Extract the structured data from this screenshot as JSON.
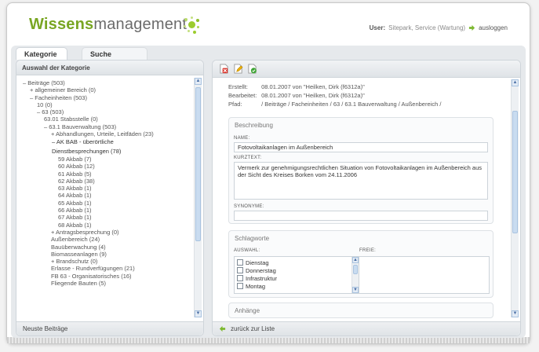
{
  "header": {
    "logo_strong": "Wissens",
    "logo_light": "management",
    "user_label": "User:",
    "user_value": "Sitepark, Service (Wartung)",
    "logout": "ausloggen"
  },
  "tabs": [
    {
      "label": "Kategorie",
      "active": true
    },
    {
      "label": "Suche",
      "active": false
    }
  ],
  "left": {
    "title": "Auswahl der Kategorie",
    "footer": "Neuste Beiträge",
    "tree": [
      {
        "text": "– Beiträge (503)",
        "indent": 0
      },
      {
        "text": "+ allgemeiner Bereich (0)",
        "indent": 1
      },
      {
        "text": "– Facheinheiten (503)",
        "indent": 1
      },
      {
        "text": "10 (0)",
        "indent": 2
      },
      {
        "text": "– 63 (503)",
        "indent": 2
      },
      {
        "text": "63.01 Stabsstelle (0)",
        "indent": 3
      },
      {
        "text": "– 63.1 Bauverwaltung (503)",
        "indent": 3
      },
      {
        "text": "+ Abhandlungen, Urteile, Leitfäden (23)",
        "indent": 4
      },
      {
        "text": "– AK BAB - überörtliche",
        "indent": 4,
        "selected": true
      },
      {
        "text": "Dienstbesprechungen (78)",
        "indent": 4,
        "selected": true
      },
      {
        "text": "59 Akbab (7)",
        "indent": 5
      },
      {
        "text": "60 Akbab (12)",
        "indent": 5
      },
      {
        "text": "61 Akbab (5)",
        "indent": 5
      },
      {
        "text": "62 Akbab (38)",
        "indent": 5
      },
      {
        "text": "63 Akbab (1)",
        "indent": 5
      },
      {
        "text": "64 Akbab (1)",
        "indent": 5
      },
      {
        "text": "65 Akbab (1)",
        "indent": 5
      },
      {
        "text": "66 Akbab (1)",
        "indent": 5
      },
      {
        "text": "67 Akbab (1)",
        "indent": 5
      },
      {
        "text": "68 Akbab (1)",
        "indent": 5
      },
      {
        "text": "+ Antragsbesprechung (0)",
        "indent": 4
      },
      {
        "text": "Außenbereich (24)",
        "indent": 4
      },
      {
        "text": "Bauüberwachung (4)",
        "indent": 4
      },
      {
        "text": "Biomasseanlagen (9)",
        "indent": 4
      },
      {
        "text": "+ Brandschutz (0)",
        "indent": 4
      },
      {
        "text": "Erlasse - Rundverfügungen (21)",
        "indent": 4
      },
      {
        "text": "FB 63 - Organisatorisches (16)",
        "indent": 4
      },
      {
        "text": "Fliegende Bauten (5)",
        "indent": 4
      }
    ]
  },
  "right": {
    "meta": [
      {
        "k": "Erstellt:",
        "v": "08.01.2007 von \"Heilken, Dirk (f6312a)\""
      },
      {
        "k": "Bearbeitet:",
        "v": "08.01.2007 von \"Heilken, Dirk (f6312a)\""
      },
      {
        "k": "Pfad:",
        "v": "/ Beiträge / Facheinheiten / 63 / 63.1 Bauverwaltung / Außenbereich /"
      }
    ],
    "beschreibung": {
      "title": "Beschreibung",
      "name_label": "NAME:",
      "name_value": "Fotovoltaikanlagen im Außenbereich",
      "kurztext_label": "KURZTEXT:",
      "kurztext_value": "Vermerk zur genehmigungsrechtlichen Situation von Fotovoltaikanlagen im Außenbereich aus der Sicht des Kreises Borken vom 24.11.2006",
      "synonyme_label": "SYNONYME:",
      "synonyme_value": ""
    },
    "schlagworte": {
      "title": "Schlagworte",
      "auswahl_label": "AUSWAHL:",
      "freie_label": "FREIE:",
      "options": [
        "Dienstag",
        "Donnerstag",
        "Infrastruktur",
        "Montag"
      ]
    },
    "anhaenge_title": "Anhänge",
    "footer": "zurück zur Liste"
  },
  "colors": {
    "logo_green": "#79a623",
    "accent_blue": "#a9c3e0"
  }
}
